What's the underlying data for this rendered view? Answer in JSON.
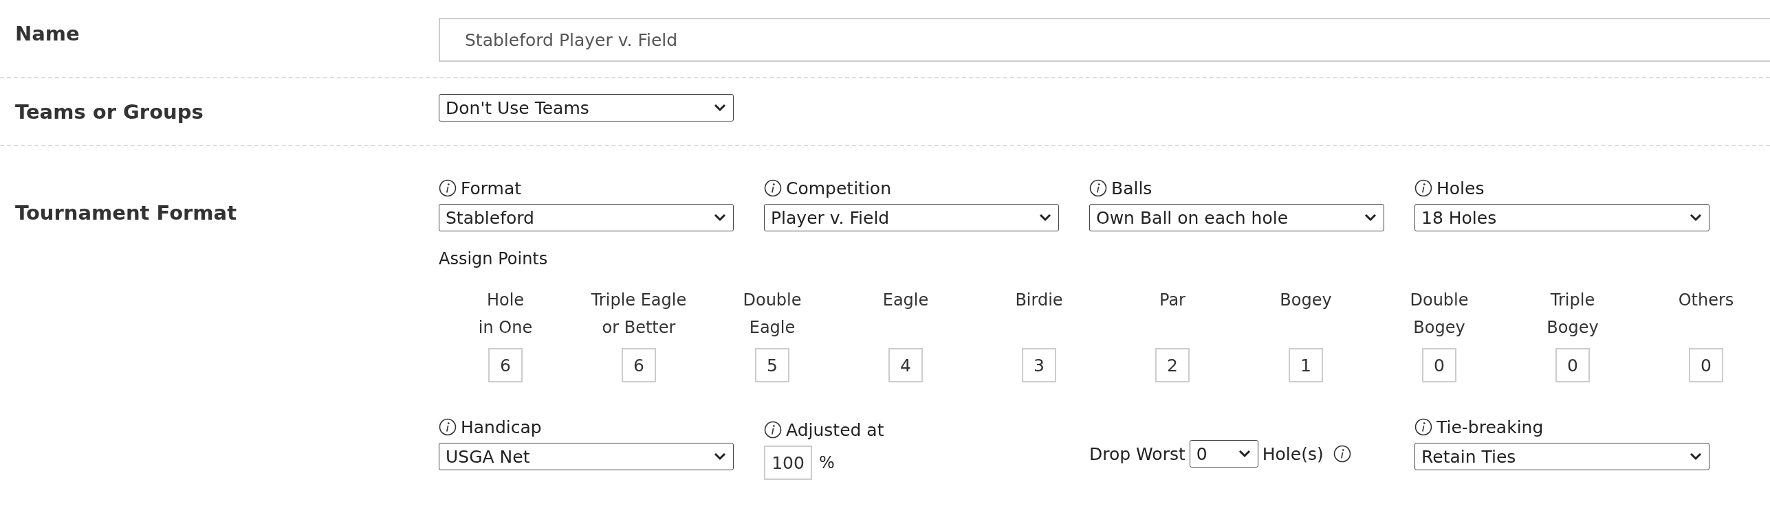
{
  "name_row": {
    "label": "Name",
    "value": "Stableford Player v. Field"
  },
  "teams_row": {
    "label": "Teams or Groups",
    "value": "Don't Use Teams"
  },
  "format_row": {
    "label": "Tournament Format",
    "selects": [
      {
        "label": "Format",
        "value": "Stableford"
      },
      {
        "label": "Competition",
        "value": "Player v. Field"
      },
      {
        "label": "Balls",
        "value": "Own Ball on each hole"
      },
      {
        "label": "Holes",
        "value": "18 Holes"
      }
    ],
    "assign_points": {
      "title": "Assign Points",
      "items": [
        {
          "label": "Hole\nin One",
          "value": "6"
        },
        {
          "label": "Triple Eagle\nor Better",
          "value": "6"
        },
        {
          "label": "Double\nEagle",
          "value": "5"
        },
        {
          "label": "Eagle",
          "value": "4"
        },
        {
          "label": "Birdie",
          "value": "3"
        },
        {
          "label": "Par",
          "value": "2"
        },
        {
          "label": "Bogey",
          "value": "1"
        },
        {
          "label": "Double\nBogey",
          "value": "0"
        },
        {
          "label": "Triple\nBogey",
          "value": "0"
        },
        {
          "label": "Others",
          "value": "0"
        }
      ]
    },
    "handicap": {
      "label": "Handicap",
      "value": "USGA Net"
    },
    "adjusted": {
      "label": "Adjusted at",
      "value": "100",
      "unit": "%"
    },
    "drop_worst": {
      "label": "Drop Worst",
      "value": "0",
      "unit": "Hole(s)"
    },
    "tie_breaking": {
      "label": "Tie-breaking",
      "value": "Retain Ties"
    }
  }
}
